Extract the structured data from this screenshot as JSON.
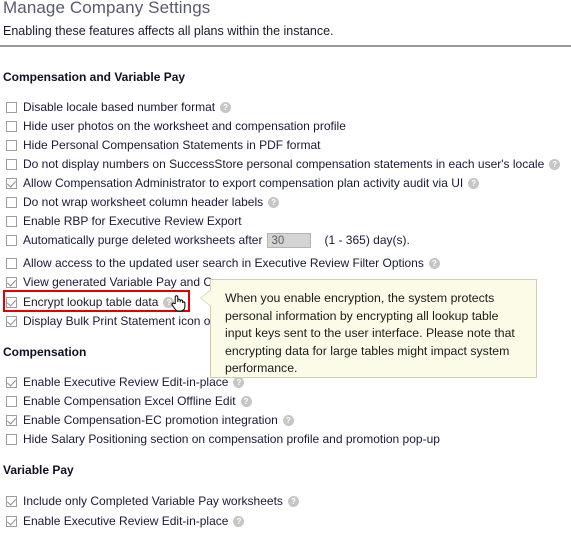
{
  "header": {
    "title": "Manage Company Settings",
    "subtitle": "Enabling these features affects all plans within the instance."
  },
  "sections": [
    {
      "heading": "Compensation and Variable Pay",
      "options": [
        {
          "label": "Disable locale based number format",
          "checked": false,
          "help": true
        },
        {
          "label": "Hide user photos on the worksheet and compensation profile",
          "checked": false,
          "help": false
        },
        {
          "label": "Hide Personal Compensation Statements in PDF format",
          "checked": false,
          "help": false
        },
        {
          "label": "Do not display numbers on SuccessStore personal compensation statements in each user's locale",
          "checked": false,
          "help": true
        },
        {
          "label": "Allow Compensation Administrator to export compensation plan activity audit via UI",
          "checked": true,
          "help": true
        },
        {
          "label": "Do not wrap worksheet column header labels",
          "checked": false,
          "help": true
        },
        {
          "label": "Enable RBP for Executive Review Export",
          "checked": false,
          "help": false
        },
        {
          "label": "Automatically purge deleted worksheets after",
          "checked": false,
          "help": false,
          "input_value": "30",
          "suffix": "(1 - 365) day(s)."
        },
        {
          "label": "Allow access to the updated user search in Executive Review Filter Options",
          "checked": false,
          "help": true
        },
        {
          "label": "View generated Variable Pay and C",
          "checked": true,
          "help": false
        },
        {
          "label": "Encrypt lookup table data",
          "checked": true,
          "help": true,
          "highlighted": true
        },
        {
          "label": "Display Bulk Print Statement icon o",
          "checked": true,
          "help": false
        }
      ]
    },
    {
      "heading": "Compensation",
      "options": [
        {
          "label": "Enable Executive Review Edit-in-place",
          "checked": true,
          "help": true
        },
        {
          "label": "Enable Compensation Excel Offline Edit",
          "checked": false,
          "help": true
        },
        {
          "label": "Enable Compensation-EC promotion integration",
          "checked": true,
          "help": true
        },
        {
          "label": "Hide Salary Positioning section on compensation profile and promotion pop-up",
          "checked": false,
          "help": false
        }
      ]
    },
    {
      "heading": "Variable Pay",
      "options": [
        {
          "label": "Include only Completed Variable Pay worksheets",
          "checked": true,
          "help": true
        },
        {
          "label": "Enable Executive Review Edit-in-place",
          "checked": true,
          "help": true
        }
      ]
    }
  ],
  "tooltip": {
    "text": "When you enable encryption, the system protects personal information by encrypting all lookup table input keys sent to the user interface. Please note that encrypting data for large tables might impact system performance."
  },
  "icons": {
    "help": "?"
  },
  "colors": {
    "highlight": "#e00000",
    "tooltip_bg": "#fbfbe8",
    "title": "#5a5a6e"
  }
}
